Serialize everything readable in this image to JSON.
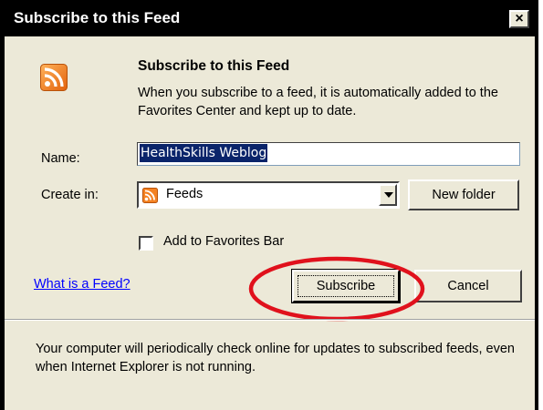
{
  "window": {
    "title": "Subscribe to this Feed",
    "close_glyph": "×"
  },
  "header": {
    "icon": "rss-feed-icon",
    "title": "Subscribe to this Feed",
    "description": "When you subscribe to a feed, it is automatically added to the Favorites Center and kept up to date."
  },
  "form": {
    "name_label": "Name:",
    "name_value": "HealthSkills Weblog",
    "create_in_label": "Create in:",
    "create_in_value": "Feeds",
    "create_in_icon": "rss-feed-icon",
    "new_folder_label": "New folder",
    "favorites_bar_label": "Add to Favorites Bar",
    "favorites_bar_checked": false
  },
  "actions": {
    "help_link": "What is a Feed?",
    "subscribe_label": "Subscribe",
    "cancel_label": "Cancel"
  },
  "footer": {
    "note": "Your computer will periodically check online for updates to subscribed feeds, even when Internet Explorer is not running."
  },
  "colors": {
    "rss_orange": "#f48222",
    "highlight_circle": "#e0111c",
    "dialog_bg": "#ece9d8",
    "selection": "#0a246a"
  }
}
